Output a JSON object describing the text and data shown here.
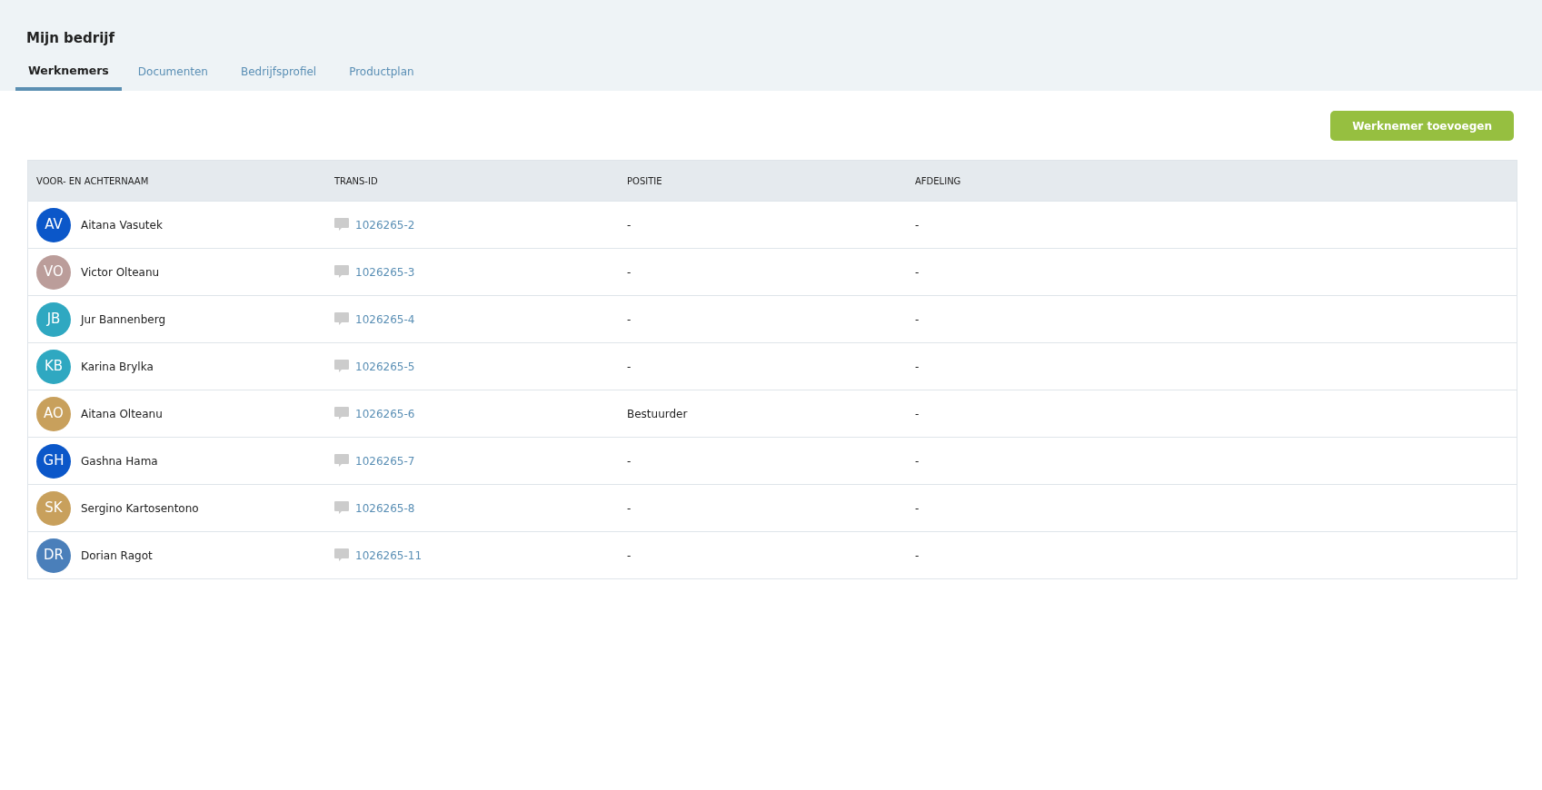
{
  "page": {
    "title": "Mijn bedrijf"
  },
  "tabs": [
    {
      "label": "Werknemers",
      "selected": true
    },
    {
      "label": "Documenten",
      "selected": false
    },
    {
      "label": "Bedrijfsprofiel",
      "selected": false
    },
    {
      "label": "Productplan",
      "selected": false
    }
  ],
  "add_button": "Werknemer toevoegen",
  "table": {
    "columns": [
      "VOOR- EN ACHTERNAAM",
      "TRANS-ID",
      "POSITIE",
      "AFDELING"
    ],
    "rows": [
      {
        "initials": "AV",
        "color": "#0b57c9",
        "name": "Aitana Vasutek",
        "trans_id": "1026265-2",
        "position": "-",
        "department": "-"
      },
      {
        "initials": "VO",
        "color": "#bb9d9a",
        "name": "Victor Olteanu",
        "trans_id": "1026265-3",
        "position": "-",
        "department": "-"
      },
      {
        "initials": "JB",
        "color": "#2fa8c1",
        "name": "Jur Bannenberg",
        "trans_id": "1026265-4",
        "position": "-",
        "department": "-"
      },
      {
        "initials": "KB",
        "color": "#2fa8c1",
        "name": "Karina Brylka",
        "trans_id": "1026265-5",
        "position": "-",
        "department": "-"
      },
      {
        "initials": "AO",
        "color": "#c8a05c",
        "name": "Aitana Olteanu",
        "trans_id": "1026265-6",
        "position": "Bestuurder",
        "department": "-"
      },
      {
        "initials": "GH",
        "color": "#0b57c9",
        "name": "Gashna Hama",
        "trans_id": "1026265-7",
        "position": "-",
        "department": "-"
      },
      {
        "initials": "SK",
        "color": "#c8a05c",
        "name": "Sergino Kartosentono",
        "trans_id": "1026265-8",
        "position": "-",
        "department": "-"
      },
      {
        "initials": "DR",
        "color": "#4a7fba",
        "name": "Dorian Ragot",
        "trans_id": "1026265-11",
        "position": "-",
        "department": "-"
      }
    ]
  }
}
